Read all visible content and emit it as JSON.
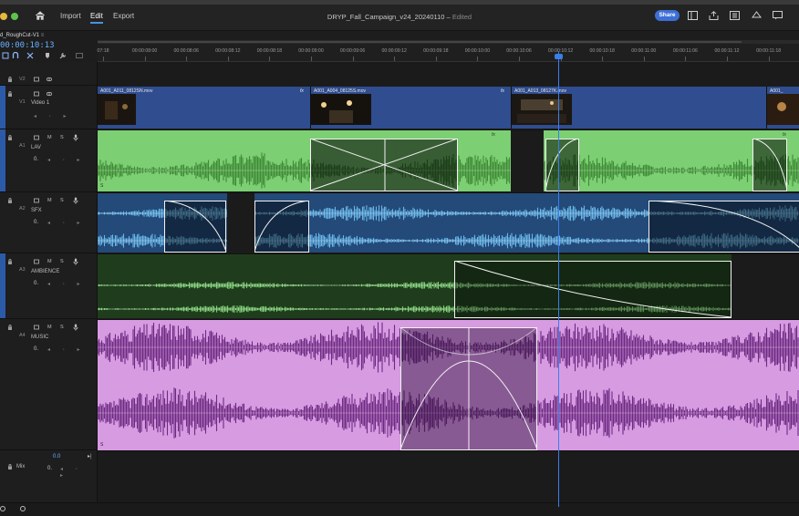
{
  "app": {
    "nav": {
      "import": "Import",
      "edit": "Edit",
      "export": "Export"
    },
    "title": "DRYP_Fall_Campaign_v24_20240110",
    "title_sep": " – ",
    "status": "Edited",
    "share_label": "Share"
  },
  "timeline": {
    "sequence_tab": "d_RoughCut-V1",
    "sequence_tab_suffix": "≡",
    "timecode": "00:00:10:13",
    "ruler_ticks": [
      "07:18",
      "00:00:08:00",
      "00:00:08:06",
      "00:00:08:12",
      "00:00:08:18",
      "00:00:09:00",
      "00:00:09:06",
      "00:00:09:12",
      "00:00:09:18",
      "00:00:10:00",
      "00:00:10:06",
      "00:00:10:12",
      "00:00:10:18",
      "00:00:11:00",
      "00:00:11:06",
      "00:00:11:12",
      "00:00:11:18"
    ],
    "tracks": {
      "v2": {
        "id": "V2"
      },
      "v1": {
        "id": "V1",
        "name": "Video 1"
      },
      "a1": {
        "id": "A1",
        "name": "LAV",
        "m": "M",
        "s": "S",
        "vol": "0."
      },
      "a2": {
        "id": "A2",
        "name": "SFX",
        "m": "M",
        "s": "S",
        "vol": "0."
      },
      "a3": {
        "id": "A3",
        "name": "AMBIENCE",
        "m": "M",
        "s": "S",
        "vol": "0."
      },
      "a4": {
        "id": "A4",
        "name": "MUSIC",
        "m": "M",
        "s": "S",
        "vol": "0."
      }
    },
    "mix": {
      "label": "Mix",
      "value": "0.0",
      "vol": "0."
    },
    "clips": {
      "v1": [
        "A001_A011_0812SN.mov",
        "A001_A004_08125S.mov",
        "A001_A013_08127K.mov",
        "A001_"
      ],
      "fx": "fx",
      "clip_marker": "S"
    },
    "colors": {
      "video_clip": "#2f4d8f",
      "lav": "#7ccf73",
      "sfx": "#234a78",
      "sfx_wave": "#6ab6e8",
      "ambience": "#1f3d1c",
      "ambience_wave": "#7fcf77",
      "music": "#d79be2",
      "music_dark": "#6d2a82",
      "playhead": "#3b7ee8"
    }
  }
}
